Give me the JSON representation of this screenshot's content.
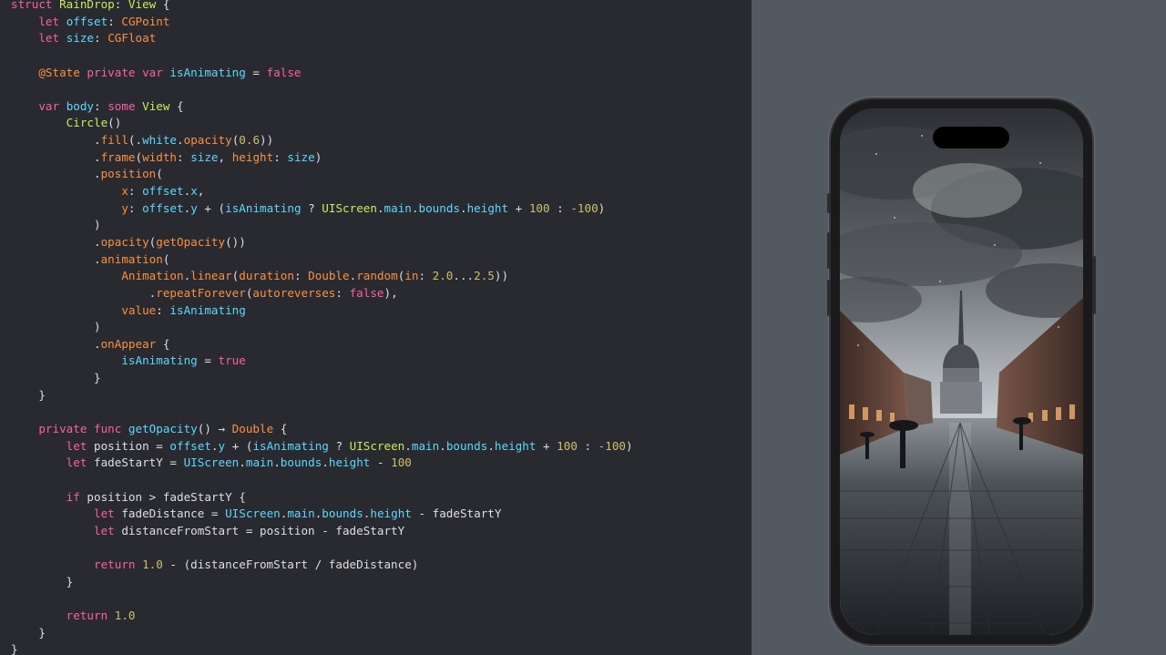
{
  "editor": {
    "lines": [
      [
        [
          "kw",
          "struct "
        ],
        [
          "type",
          "RainDrop"
        ],
        [
          "plain",
          ": "
        ],
        [
          "type",
          "View"
        ],
        [
          "plain",
          " {"
        ]
      ],
      [
        [
          "plain",
          "    "
        ],
        [
          "kw",
          "let "
        ],
        [
          "prop",
          "offset"
        ],
        [
          "plain",
          ": "
        ],
        [
          "attr",
          "CGPoint"
        ]
      ],
      [
        [
          "plain",
          "    "
        ],
        [
          "kw",
          "let "
        ],
        [
          "prop",
          "size"
        ],
        [
          "plain",
          ": "
        ],
        [
          "attr",
          "CGFloat"
        ]
      ],
      [],
      [
        [
          "plain",
          "    "
        ],
        [
          "attr",
          "@State "
        ],
        [
          "kw",
          "private var "
        ],
        [
          "prop",
          "isAnimating"
        ],
        [
          "plain",
          " = "
        ],
        [
          "kw",
          "false"
        ]
      ],
      [],
      [
        [
          "plain",
          "    "
        ],
        [
          "kw",
          "var "
        ],
        [
          "prop",
          "body"
        ],
        [
          "plain",
          ": "
        ],
        [
          "kw",
          "some "
        ],
        [
          "type",
          "View"
        ],
        [
          "plain",
          " {"
        ]
      ],
      [
        [
          "plain",
          "        "
        ],
        [
          "type",
          "Circle"
        ],
        [
          "plain",
          "()"
        ]
      ],
      [
        [
          "plain",
          "            ."
        ],
        [
          "attr",
          "fill"
        ],
        [
          "plain",
          "(."
        ],
        [
          "prop",
          "white"
        ],
        [
          "plain",
          "."
        ],
        [
          "attr",
          "opacity"
        ],
        [
          "plain",
          "("
        ],
        [
          "num",
          "0.6"
        ],
        [
          "plain",
          "))"
        ]
      ],
      [
        [
          "plain",
          "            ."
        ],
        [
          "attr",
          "frame"
        ],
        [
          "plain",
          "("
        ],
        [
          "attr",
          "width"
        ],
        [
          "plain",
          ": "
        ],
        [
          "prop",
          "size"
        ],
        [
          "plain",
          ", "
        ],
        [
          "attr",
          "height"
        ],
        [
          "plain",
          ": "
        ],
        [
          "prop",
          "size"
        ],
        [
          "plain",
          ")"
        ]
      ],
      [
        [
          "plain",
          "            ."
        ],
        [
          "attr",
          "position"
        ],
        [
          "plain",
          "("
        ]
      ],
      [
        [
          "plain",
          "                "
        ],
        [
          "attr",
          "x"
        ],
        [
          "plain",
          ": "
        ],
        [
          "prop",
          "offset"
        ],
        [
          "plain",
          "."
        ],
        [
          "prop",
          "x"
        ],
        [
          "plain",
          ","
        ]
      ],
      [
        [
          "plain",
          "                "
        ],
        [
          "attr",
          "y"
        ],
        [
          "plain",
          ": "
        ],
        [
          "prop",
          "offset"
        ],
        [
          "plain",
          "."
        ],
        [
          "prop",
          "y"
        ],
        [
          "plain",
          " + ("
        ],
        [
          "prop",
          "isAnimating"
        ],
        [
          "plain",
          " ? "
        ],
        [
          "sys",
          "UIScreen"
        ],
        [
          "plain",
          "."
        ],
        [
          "prop",
          "main"
        ],
        [
          "plain",
          "."
        ],
        [
          "prop",
          "bounds"
        ],
        [
          "plain",
          "."
        ],
        [
          "prop",
          "height"
        ],
        [
          "plain",
          " + "
        ],
        [
          "num",
          "100"
        ],
        [
          "plain",
          " : "
        ],
        [
          "num",
          "-100"
        ],
        [
          "plain",
          ")"
        ]
      ],
      [
        [
          "plain",
          "            )"
        ]
      ],
      [
        [
          "plain",
          "            ."
        ],
        [
          "attr",
          "opacity"
        ],
        [
          "plain",
          "("
        ],
        [
          "attr",
          "getOpacity"
        ],
        [
          "plain",
          "())"
        ]
      ],
      [
        [
          "plain",
          "            ."
        ],
        [
          "attr",
          "animation"
        ],
        [
          "plain",
          "("
        ]
      ],
      [
        [
          "plain",
          "                "
        ],
        [
          "attr",
          "Animation"
        ],
        [
          "plain",
          "."
        ],
        [
          "attr",
          "linear"
        ],
        [
          "plain",
          "("
        ],
        [
          "attr",
          "duration"
        ],
        [
          "plain",
          ": "
        ],
        [
          "attr",
          "Double"
        ],
        [
          "plain",
          "."
        ],
        [
          "attr",
          "random"
        ],
        [
          "plain",
          "("
        ],
        [
          "attr",
          "in"
        ],
        [
          "plain",
          ": "
        ],
        [
          "num",
          "2.0"
        ],
        [
          "plain",
          "..."
        ],
        [
          "num",
          "2.5"
        ],
        [
          "plain",
          "))"
        ]
      ],
      [
        [
          "plain",
          "                    ."
        ],
        [
          "attr",
          "repeatForever"
        ],
        [
          "plain",
          "("
        ],
        [
          "attr",
          "autoreverses"
        ],
        [
          "plain",
          ": "
        ],
        [
          "kw",
          "false"
        ],
        [
          "plain",
          "),"
        ]
      ],
      [
        [
          "plain",
          "                "
        ],
        [
          "attr",
          "value"
        ],
        [
          "plain",
          ": "
        ],
        [
          "prop",
          "isAnimating"
        ]
      ],
      [
        [
          "plain",
          "            )"
        ]
      ],
      [
        [
          "plain",
          "            ."
        ],
        [
          "attr",
          "onAppear"
        ],
        [
          "plain",
          " {"
        ]
      ],
      [
        [
          "plain",
          "                "
        ],
        [
          "prop",
          "isAnimating"
        ],
        [
          "plain",
          " = "
        ],
        [
          "kw",
          "true"
        ]
      ],
      [
        [
          "plain",
          "            }"
        ]
      ],
      [
        [
          "plain",
          "    }"
        ]
      ],
      [],
      [
        [
          "plain",
          "    "
        ],
        [
          "kw",
          "private func "
        ],
        [
          "prop",
          "getOpacity"
        ],
        [
          "plain",
          "() → "
        ],
        [
          "attr",
          "Double"
        ],
        [
          "plain",
          " {"
        ]
      ],
      [
        [
          "plain",
          "        "
        ],
        [
          "kw",
          "let "
        ],
        [
          "plain",
          "position = "
        ],
        [
          "prop",
          "offset"
        ],
        [
          "plain",
          "."
        ],
        [
          "prop",
          "y"
        ],
        [
          "plain",
          " + ("
        ],
        [
          "prop",
          "isAnimating"
        ],
        [
          "plain",
          " ? "
        ],
        [
          "sys",
          "UIScreen"
        ],
        [
          "plain",
          "."
        ],
        [
          "prop",
          "main"
        ],
        [
          "plain",
          "."
        ],
        [
          "prop",
          "bounds"
        ],
        [
          "plain",
          "."
        ],
        [
          "prop",
          "height"
        ],
        [
          "plain",
          " + "
        ],
        [
          "num",
          "100"
        ],
        [
          "plain",
          " : "
        ],
        [
          "num",
          "-100"
        ],
        [
          "plain",
          ")"
        ]
      ],
      [
        [
          "plain",
          "        "
        ],
        [
          "kw",
          "let "
        ],
        [
          "plain",
          "fadeStartY = "
        ],
        [
          "prop",
          "UIScreen"
        ],
        [
          "plain",
          "."
        ],
        [
          "prop",
          "main"
        ],
        [
          "plain",
          "."
        ],
        [
          "prop",
          "bounds"
        ],
        [
          "plain",
          "."
        ],
        [
          "prop",
          "height"
        ],
        [
          "plain",
          " - "
        ],
        [
          "num",
          "100"
        ]
      ],
      [],
      [
        [
          "plain",
          "        "
        ],
        [
          "kw",
          "if "
        ],
        [
          "plain",
          "position > fadeStartY {"
        ]
      ],
      [
        [
          "plain",
          "            "
        ],
        [
          "kw",
          "let "
        ],
        [
          "plain",
          "fadeDistance = "
        ],
        [
          "prop",
          "UIScreen"
        ],
        [
          "plain",
          "."
        ],
        [
          "prop",
          "main"
        ],
        [
          "plain",
          "."
        ],
        [
          "prop",
          "bounds"
        ],
        [
          "plain",
          "."
        ],
        [
          "prop",
          "height"
        ],
        [
          "plain",
          " - fadeStartY"
        ]
      ],
      [
        [
          "plain",
          "            "
        ],
        [
          "kw",
          "let "
        ],
        [
          "plain",
          "distanceFromStart = position - fadeStartY"
        ]
      ],
      [],
      [
        [
          "plain",
          "            "
        ],
        [
          "kw",
          "return "
        ],
        [
          "num",
          "1.0"
        ],
        [
          "plain",
          " - (distanceFromStart / fadeDistance)"
        ]
      ],
      [
        [
          "plain",
          "        }"
        ]
      ],
      [],
      [
        [
          "plain",
          "        "
        ],
        [
          "kw",
          "return "
        ],
        [
          "num",
          "1.0"
        ]
      ],
      [
        [
          "plain",
          "    }"
        ]
      ],
      [
        [
          "plain",
          "}"
        ]
      ]
    ]
  },
  "preview": {
    "image_description": "Rainy Turin piazza with Mole Antonelliana, people with umbrellas"
  }
}
